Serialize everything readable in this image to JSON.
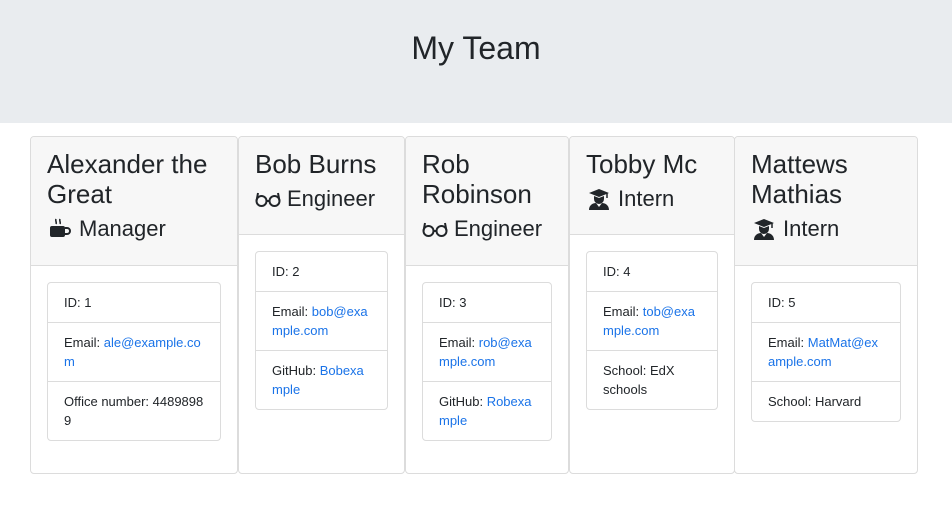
{
  "header": {
    "title": "My Team"
  },
  "team": [
    {
      "name": "Alexander the Great",
      "role": "Manager",
      "role_icon": "coffee-icon",
      "id_text": "ID: 1",
      "email_label": "Email: ",
      "email": "ale@example.com",
      "extra_label": "Office number: ",
      "extra_value": "44898989"
    },
    {
      "name": "Bob Burns",
      "role": "Engineer",
      "role_icon": "glasses-icon",
      "id_text": "ID: 2",
      "email_label": "Email: ",
      "email": "bob@example.com",
      "extra_label": "GitHub: ",
      "extra_value": "Bobexample"
    },
    {
      "name": "Rob Robinson",
      "role": "Engineer",
      "role_icon": "glasses-icon",
      "id_text": "ID: 3",
      "email_label": "Email: ",
      "email": "rob@example.com",
      "extra_label": "GitHub: ",
      "extra_value": "Robexample"
    },
    {
      "name": "Tobby Mc",
      "role": "Intern",
      "role_icon": "graduate-icon",
      "id_text": "ID: 4",
      "email_label": "Email: ",
      "email": "tob@example.com",
      "extra_label": "School: ",
      "extra_value": "EdX schools"
    },
    {
      "name": "Mattews Mathias",
      "role": "Intern",
      "role_icon": "graduate-icon",
      "id_text": "ID: 5",
      "email_label": "Email: ",
      "email": "MatMat@example.com",
      "extra_label": "School: ",
      "extra_value": "Harvard"
    }
  ],
  "colors": {
    "header_bg": "#e9ecef",
    "link": "#1a73e8",
    "card_header_bg": "#f7f7f7"
  }
}
